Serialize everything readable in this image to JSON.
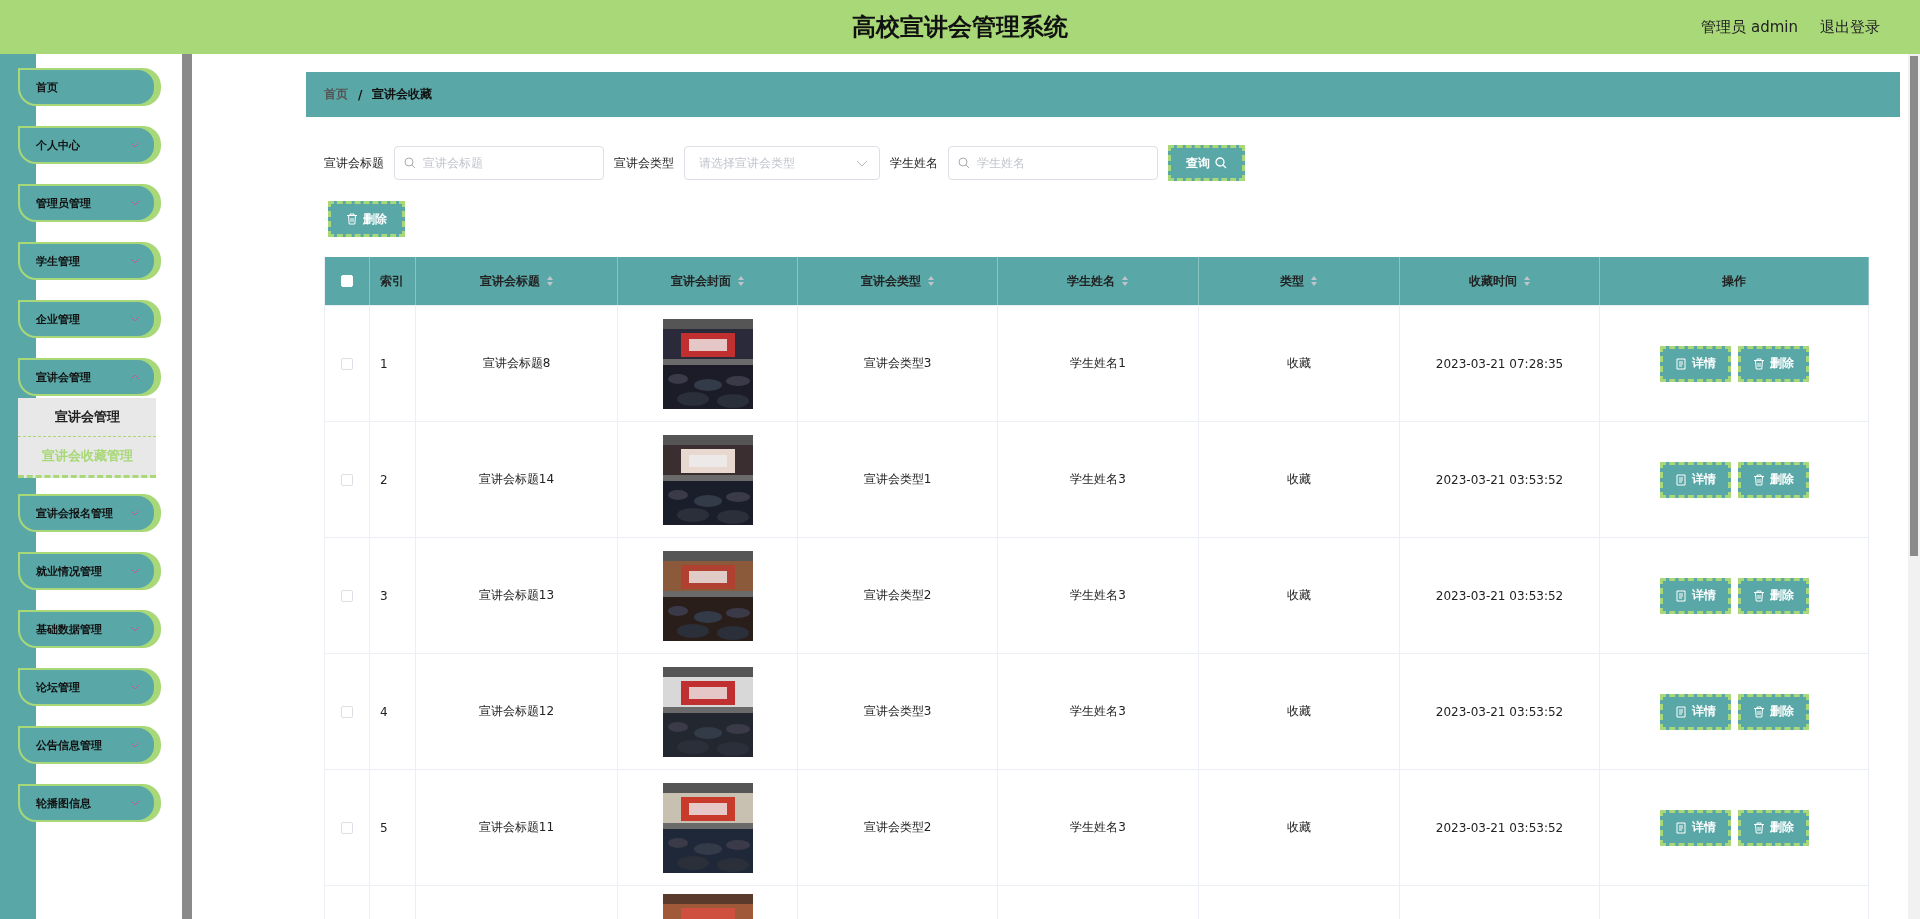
{
  "header": {
    "title": "高校宣讲会管理系统",
    "user": "管理员 admin",
    "logout": "退出登录"
  },
  "sidebar": {
    "items": [
      {
        "label": "首页",
        "kind": "link"
      },
      {
        "label": "个人中心",
        "kind": "menu",
        "expanded": false
      },
      {
        "label": "管理员管理",
        "kind": "menu",
        "expanded": false
      },
      {
        "label": "学生管理",
        "kind": "menu",
        "expanded": false
      },
      {
        "label": "企业管理",
        "kind": "menu",
        "expanded": false
      },
      {
        "label": "宣讲会管理",
        "kind": "menu",
        "expanded": true,
        "children": [
          {
            "label": "宣讲会管理",
            "selected": false
          },
          {
            "label": "宣讲会收藏管理",
            "selected": true
          }
        ]
      },
      {
        "label": "宣讲会报名管理",
        "kind": "menu",
        "expanded": false
      },
      {
        "label": "就业情况管理",
        "kind": "menu",
        "expanded": false
      },
      {
        "label": "基础数据管理",
        "kind": "menu",
        "expanded": false
      },
      {
        "label": "论坛管理",
        "kind": "menu",
        "expanded": false
      },
      {
        "label": "公告信息管理",
        "kind": "menu",
        "expanded": false
      },
      {
        "label": "轮播图信息",
        "kind": "menu",
        "expanded": false
      }
    ]
  },
  "breadcrumb": [
    "首页",
    "宣讲会收藏"
  ],
  "breadcrumb_separator": "/",
  "search": {
    "fields": [
      {
        "label": "宣讲会标题",
        "placeholder": "宣讲会标题",
        "kind": "text"
      },
      {
        "label": "宣讲会类型",
        "placeholder": "请选择宣讲会类型",
        "kind": "select"
      },
      {
        "label": "学生姓名",
        "placeholder": "学生姓名",
        "kind": "text"
      }
    ],
    "button": "查询"
  },
  "delete_button": "删除",
  "table": {
    "all_checked": false,
    "columns": [
      {
        "label": "索引",
        "sortable": false
      },
      {
        "label": "宣讲会标题",
        "sortable": true
      },
      {
        "label": "宣讲会封面",
        "sortable": true
      },
      {
        "label": "宣讲会类型",
        "sortable": true
      },
      {
        "label": "学生姓名",
        "sortable": true
      },
      {
        "label": "类型",
        "sortable": true
      },
      {
        "label": "收藏时间",
        "sortable": true
      },
      {
        "label": "操作",
        "sortable": false
      }
    ],
    "rows": [
      {
        "checked": false,
        "index": "1",
        "title": "宣讲会标题8",
        "cover": {
          "kind": "picture"
        },
        "type": "宣讲会类型3",
        "student": "学生姓名1",
        "kind_text": "收藏",
        "time": "2023-03-21 07:28:35",
        "actions": [
          "详情",
          "删除"
        ]
      },
      {
        "checked": false,
        "index": "2",
        "title": "宣讲会标题14",
        "cover": {
          "kind": "picture"
        },
        "type": "宣讲会类型1",
        "student": "学生姓名3",
        "kind_text": "收藏",
        "time": "2023-03-21 03:53:52",
        "actions": [
          "详情",
          "删除"
        ]
      },
      {
        "checked": false,
        "index": "3",
        "title": "宣讲会标题13",
        "cover": {
          "kind": "picture"
        },
        "type": "宣讲会类型2",
        "student": "学生姓名3",
        "kind_text": "收藏",
        "time": "2023-03-21 03:53:52",
        "actions": [
          "详情",
          "删除"
        ]
      },
      {
        "checked": false,
        "index": "4",
        "title": "宣讲会标题12",
        "cover": {
          "kind": "picture"
        },
        "type": "宣讲会类型3",
        "student": "学生姓名3",
        "kind_text": "收藏",
        "time": "2023-03-21 03:53:52",
        "actions": [
          "详情",
          "删除"
        ]
      },
      {
        "checked": false,
        "index": "5",
        "title": "宣讲会标题11",
        "cover": {
          "kind": "picture"
        },
        "type": "宣讲会类型2",
        "student": "学生姓名3",
        "kind_text": "收藏",
        "time": "2023-03-21 03:53:52",
        "actions": [
          "详情",
          "删除"
        ]
      }
    ],
    "partial_row": {
      "cover": {
        "kind": "picture"
      }
    }
  }
}
